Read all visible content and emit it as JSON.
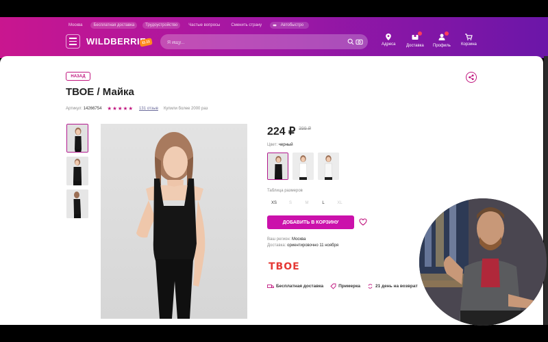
{
  "header": {
    "top_links": [
      "Москва",
      "Бесплатная доставка",
      "Трудоустройство",
      "Частые вопросы",
      "Сменить страну",
      "Автобыстро"
    ],
    "logo": "WILDBERRIES",
    "logo_badge": "11.11",
    "search_placeholder": "Я ищу...",
    "nav": [
      {
        "label": "Адреса",
        "icon": "location-pin-icon"
      },
      {
        "label": "Доставка",
        "icon": "delivery-box-icon"
      },
      {
        "label": "Профиль",
        "icon": "user-icon"
      },
      {
        "label": "Корзина",
        "icon": "cart-icon"
      }
    ]
  },
  "product": {
    "back_label": "НАЗАД",
    "title": "ТВОЕ / Майка",
    "article_label": "Артикул:",
    "article": "14266754",
    "rating": 5,
    "stars": "★★★★★",
    "reviews": "131 отзыв",
    "bought": "Купили более 2000 раз",
    "price": "224 ₽",
    "old_price": "399 ₽",
    "color_label": "Цвет:",
    "color": "черный",
    "size_table_label": "Таблица размеров",
    "sizes": [
      {
        "label": "XS",
        "available": true
      },
      {
        "label": "S",
        "available": false
      },
      {
        "label": "M",
        "available": false
      },
      {
        "label": "L",
        "available": true
      },
      {
        "label": "XL",
        "available": false
      }
    ],
    "add_to_cart": "ДОБАВИТЬ В КОРЗИНУ",
    "region_label": "Ваш регион:",
    "region": "Москва",
    "delivery_label": "Доставка:",
    "delivery": "ориентировочно 11 ноября",
    "brand": "ТВОЕ",
    "features": [
      "Бесплатная доставка",
      "Примерка",
      "21 день на возврат"
    ]
  },
  "colors": {
    "accent": "#cb11ab",
    "header_start": "#c9168f",
    "header_end": "#6b16a8",
    "brand_red": "#e53935"
  }
}
